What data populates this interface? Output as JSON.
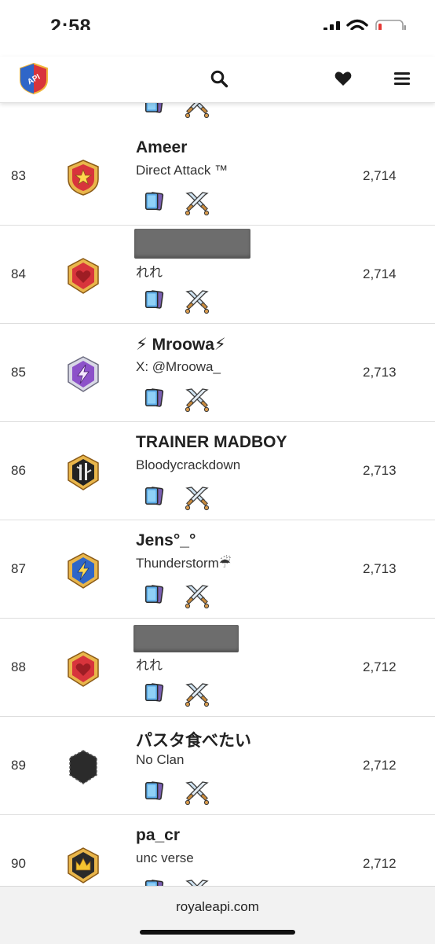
{
  "status_bar": {
    "time": "2:58"
  },
  "header": {
    "logo_text": "API",
    "icons": [
      "search-icon",
      "heart-icon",
      "menu-icon"
    ]
  },
  "rows": [
    {
      "rank": "",
      "name": "",
      "clan": "",
      "trophies": "",
      "badge": "partial"
    },
    {
      "rank": "83",
      "name": "Ameer",
      "clan": "Direct Attack ™",
      "trophies": "2,714",
      "badge": "red-star"
    },
    {
      "rank": "84",
      "name": "",
      "clan": "れれ",
      "trophies": "2,714",
      "badge": "red-heart",
      "name_redacted": true
    },
    {
      "rank": "85",
      "name": "⚡ Mroowa⚡",
      "clan": "X: @Mroowa_",
      "trophies": "2,713",
      "badge": "purple-bolt"
    },
    {
      "rank": "86",
      "name": "TRAINER MADBOY",
      "clan": "Bloodycrackdown",
      "trophies": "2,713",
      "badge": "black-bamboo"
    },
    {
      "rank": "87",
      "name": "Jens°_°",
      "clan": "Thunderstorm☔",
      "trophies": "2,713",
      "badge": "blue-bolt"
    },
    {
      "rank": "88",
      "name": "",
      "clan": "れれ",
      "trophies": "2,712",
      "badge": "red-heart",
      "name_redacted": true
    },
    {
      "rank": "89",
      "name": "パスタ食べたい",
      "clan": "No Clan",
      "trophies": "2,712",
      "badge": "no-clan"
    },
    {
      "rank": "90",
      "name": "pa_cr",
      "clan": "unc verse",
      "trophies": "2,712",
      "badge": "gold-crown"
    }
  ],
  "browser": {
    "url": "royaleapi.com"
  },
  "colors": {
    "accent_red": "#d8343c",
    "gold": "#e9b64b",
    "purple": "#8c52c9",
    "blue": "#2f66c8"
  }
}
